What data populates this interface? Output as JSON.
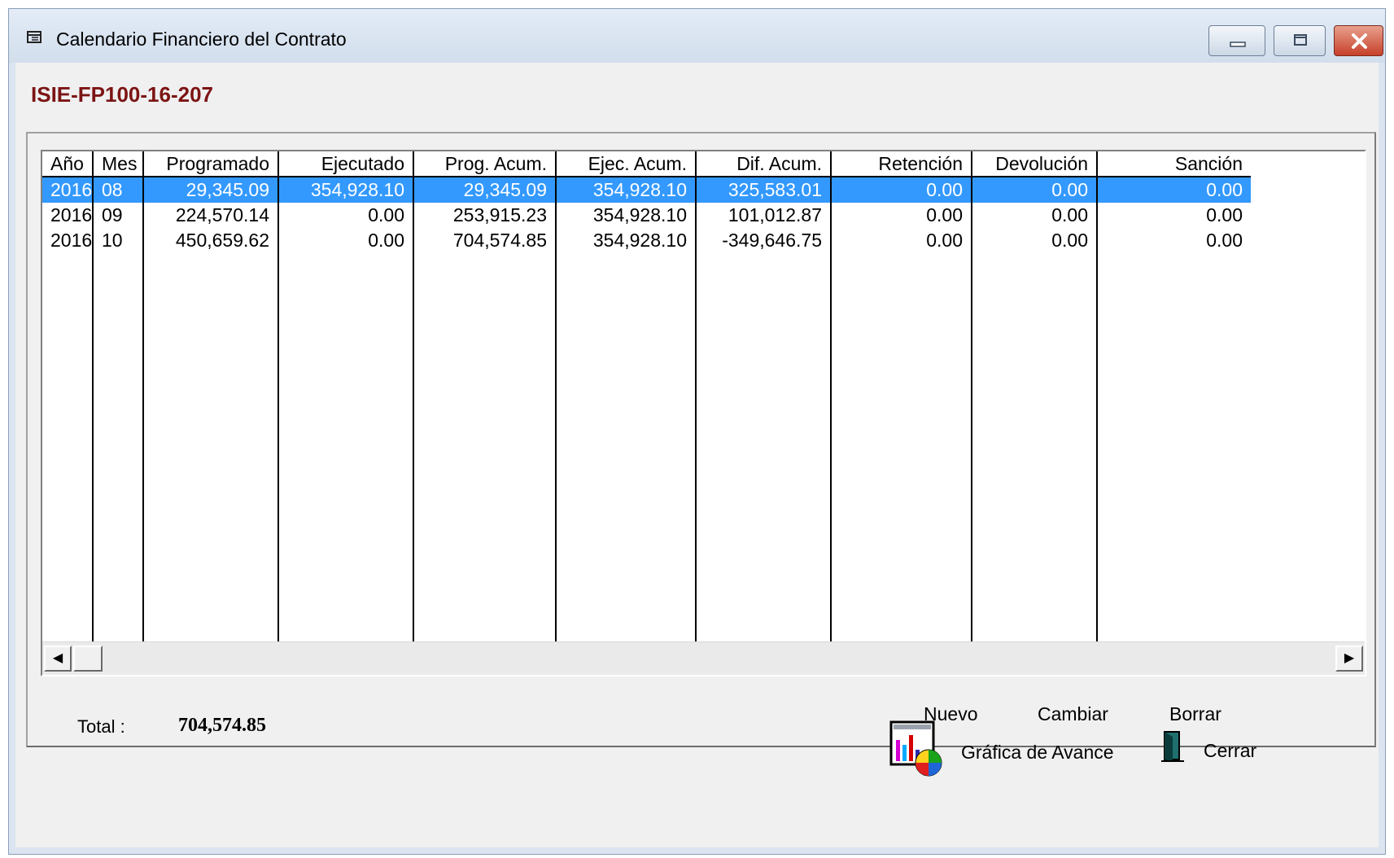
{
  "window": {
    "title": "Calendario Financiero del Contrato"
  },
  "contract": {
    "id": "ISIE-FP100-16-207"
  },
  "table": {
    "columns": [
      "Año",
      "Mes",
      "Programado",
      "Ejecutado",
      "Prog. Acum.",
      "Ejec. Acum.",
      "Dif. Acum.",
      "Retención",
      "Devolución",
      "Sanción"
    ],
    "rows": [
      [
        "2016",
        "08",
        "29,345.09",
        "354,928.10",
        "29,345.09",
        "354,928.10",
        "325,583.01",
        "0.00",
        "0.00",
        "0.00"
      ],
      [
        "2016",
        "09",
        "224,570.14",
        "0.00",
        "253,915.23",
        "354,928.10",
        "101,012.87",
        "0.00",
        "0.00",
        "0.00"
      ],
      [
        "2016",
        "10",
        "450,659.62",
        "0.00",
        "704,574.85",
        "354,928.10",
        "-349,646.75",
        "0.00",
        "0.00",
        "0.00"
      ]
    ],
    "selected_row": 0,
    "selection_color": "#3399ff"
  },
  "actions": {
    "nuevo": "Nuevo",
    "cambiar": "Cambiar",
    "borrar": "Borrar"
  },
  "total": {
    "label": "Total :",
    "value": "704,574.85"
  },
  "footer": {
    "grafica_label": "Gráfica de Avance",
    "cerrar_label": "Cerrar"
  },
  "icons": {
    "window_icon": "calendar-icon",
    "chart_icon": "chart-icon",
    "exit_icon": "door-exit-icon"
  }
}
